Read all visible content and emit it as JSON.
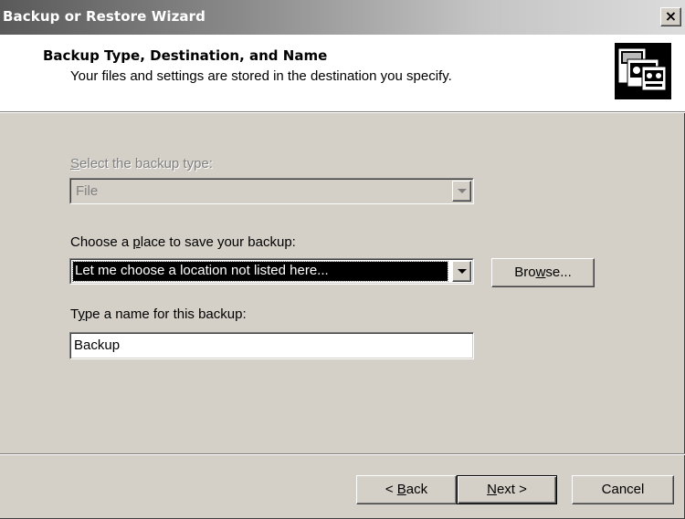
{
  "window": {
    "title": "Backup or Restore Wizard",
    "close_glyph": "×"
  },
  "header": {
    "title": "Backup Type, Destination, and Name",
    "subtitle": "Your files and settings are stored in the destination you specify.",
    "icon": "backup-media-icon"
  },
  "backup_type": {
    "label_mnemonic": "S",
    "label_rest": "elect the backup type:",
    "value": "File",
    "enabled": false
  },
  "destination": {
    "label_pre": "Choose a ",
    "label_mnemonic": "p",
    "label_post": "lace to save your backup:",
    "value": "Let me choose a location not listed here...",
    "browse_pre": "Bro",
    "browse_mnemonic": "w",
    "browse_post": "se..."
  },
  "backup_name": {
    "label_pre": "T",
    "label_mnemonic": "y",
    "label_post": "pe a name for this backup:",
    "value": "Backup"
  },
  "footer": {
    "back_pre": "< ",
    "back_mnemonic": "B",
    "back_post": "ack",
    "next_mnemonic": "N",
    "next_post": "ext >",
    "cancel_label": "Cancel"
  },
  "colors": {
    "face": "#d4d0c8",
    "title_gradient_start": "#5a5a5a",
    "title_gradient_end": "#dcdcdc",
    "header_bg": "#ffffff"
  }
}
